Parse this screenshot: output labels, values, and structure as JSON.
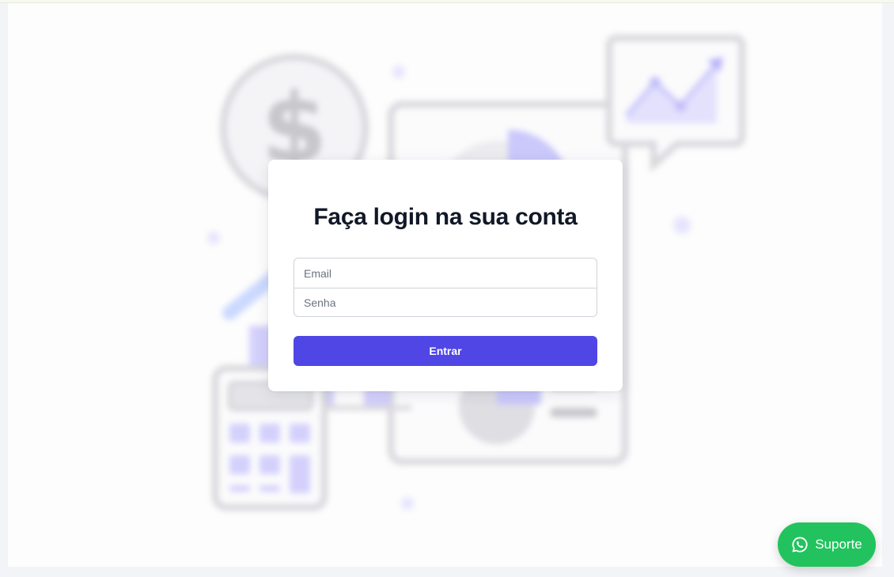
{
  "login": {
    "title": "Faça login na sua conta",
    "email_placeholder": "Email",
    "password_placeholder": "Senha",
    "submit_label": "Entrar"
  },
  "support_button": {
    "label": "Suporte",
    "icon": "whatsapp-icon",
    "color": "#22c35e"
  },
  "colors": {
    "accent": "#4f46e5",
    "title": "#111827"
  },
  "background_illustration": {
    "icons": [
      "dollar-coin-icon",
      "trend-chart-bubble-icon",
      "pie-chart-icon",
      "calculator-icon",
      "bar-chart-icon"
    ]
  }
}
